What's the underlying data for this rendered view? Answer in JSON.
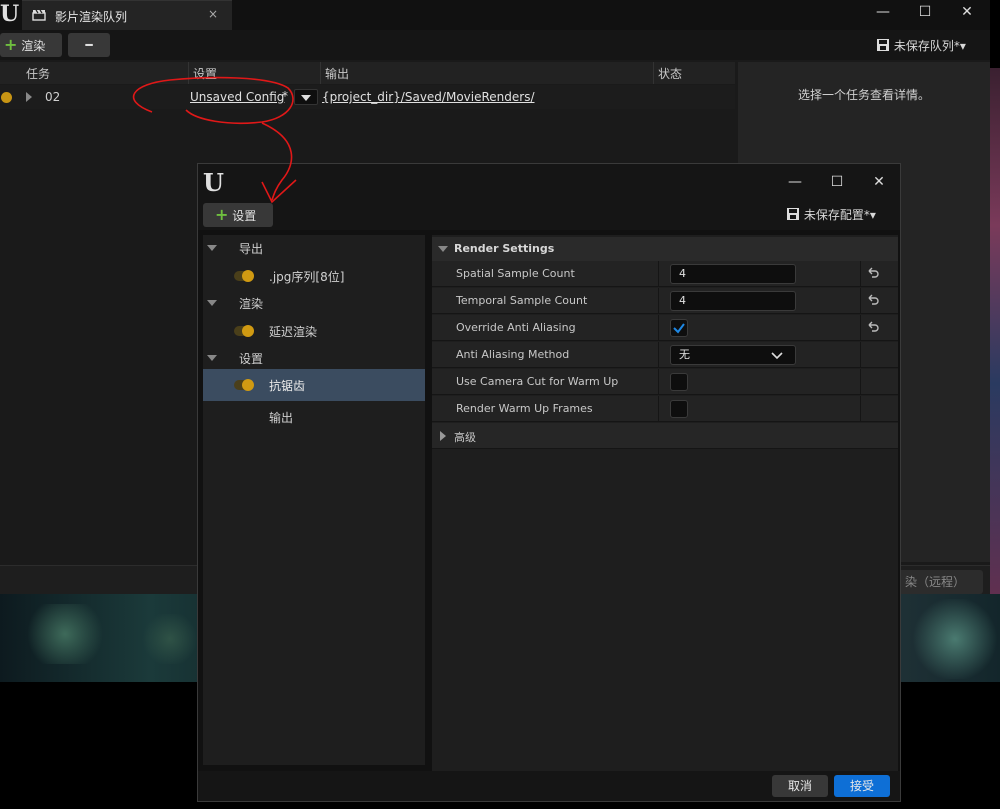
{
  "main_window": {
    "tab_title": "影片渲染队列",
    "tab_close": "×",
    "controls": {
      "minimize": "—",
      "maximize": "☐",
      "close": "✕"
    },
    "toolbar": {
      "render_label": "渲染",
      "minus_label": "━",
      "save_queue_label": "未保存队列*▾"
    },
    "queue_columns": {
      "job": "任务",
      "settings": "设置",
      "output": "输出",
      "status": "状态"
    },
    "job_row": {
      "name": "02",
      "config": "Unsaved Config",
      "config_modified": "*",
      "output_path": "{project_dir}/Saved/MovieRenders/"
    },
    "details_hint": "选择一个任务查看详情。",
    "render_remote_label": "染（远程）"
  },
  "dialog": {
    "logo": "U",
    "controls": {
      "minimize": "—",
      "maximize": "☐",
      "close": "✕"
    },
    "add_setting_label": "设置",
    "save_config_label": "未保存配置*▾",
    "tree": [
      {
        "kind": "category",
        "label": "导出"
      },
      {
        "kind": "item",
        "label": ".jpg序列[8位]",
        "enabled": true
      },
      {
        "kind": "category",
        "label": "渲染"
      },
      {
        "kind": "item",
        "label": "延迟渲染",
        "enabled": true
      },
      {
        "kind": "category",
        "label": "设置"
      },
      {
        "kind": "item",
        "label": "抗锯齿",
        "enabled": true,
        "selected": true
      },
      {
        "kind": "item",
        "label": "输出",
        "enabled": null
      }
    ],
    "section_title": "Render Settings",
    "properties": [
      {
        "label": "Spatial Sample Count",
        "type": "number",
        "value": "4",
        "resettable": true
      },
      {
        "label": "Temporal Sample Count",
        "type": "number",
        "value": "4",
        "resettable": true
      },
      {
        "label": "Override Anti Aliasing",
        "type": "checkbox",
        "value": true,
        "resettable": true
      },
      {
        "label": "Anti Aliasing Method",
        "type": "combo",
        "value": "无",
        "resettable": false
      },
      {
        "label": "Use Camera Cut for Warm Up",
        "type": "checkbox",
        "value": false,
        "resettable": false
      },
      {
        "label": "Render Warm Up Frames",
        "type": "checkbox",
        "value": false,
        "resettable": false
      }
    ],
    "advanced_label": "高级",
    "cancel_label": "取消",
    "accept_label": "接受"
  },
  "colors": {
    "accent_blue": "#0e6fd6",
    "selection": "#3b4c60",
    "toggle_on": "#d09a12",
    "plus_green": "#6fbf3f",
    "annotation_red": "#e01818"
  }
}
